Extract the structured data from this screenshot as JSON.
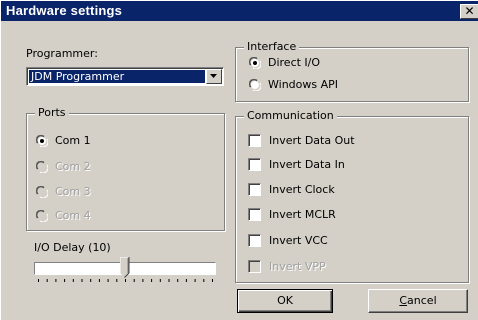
{
  "window": {
    "title": "Hardware settings",
    "close_glyph": "✕",
    "titlebar_color": "#0a246a",
    "face_color": "#d4d0c8"
  },
  "programmer": {
    "label": "Programmer:",
    "selected": "JDM Programmer"
  },
  "ports": {
    "title": "Ports",
    "options": [
      {
        "label": "Com 1",
        "checked": true,
        "enabled": true
      },
      {
        "label": "Com 2",
        "checked": false,
        "enabled": false
      },
      {
        "label": "Com 3",
        "checked": false,
        "enabled": false
      },
      {
        "label": "Com 4",
        "checked": false,
        "enabled": false
      }
    ]
  },
  "io_delay": {
    "label": "I/O Delay (10)",
    "value": 10,
    "max": 20
  },
  "interface": {
    "title": "Interface",
    "options": [
      {
        "label": "Direct I/O",
        "checked": true
      },
      {
        "label": "Windows API",
        "checked": false
      }
    ]
  },
  "communication": {
    "title": "Communication",
    "items": [
      {
        "label": "Invert Data Out",
        "checked": false,
        "enabled": true
      },
      {
        "label": "Invert Data In",
        "checked": false,
        "enabled": true
      },
      {
        "label": "Invert Clock",
        "checked": false,
        "enabled": true
      },
      {
        "label": "Invert MCLR",
        "checked": false,
        "enabled": true
      },
      {
        "label": "Invert VCC",
        "checked": false,
        "enabled": true
      },
      {
        "label": "Invert VPP",
        "checked": false,
        "enabled": false
      }
    ]
  },
  "buttons": {
    "ok": "OK",
    "cancel_underlined": "C",
    "cancel_rest": "ancel"
  },
  "icons": {
    "combo_arrow": "chevron-down-icon",
    "radio_selected": "radio-selected-icon",
    "radio_unselected": "radio-unselected-icon"
  }
}
